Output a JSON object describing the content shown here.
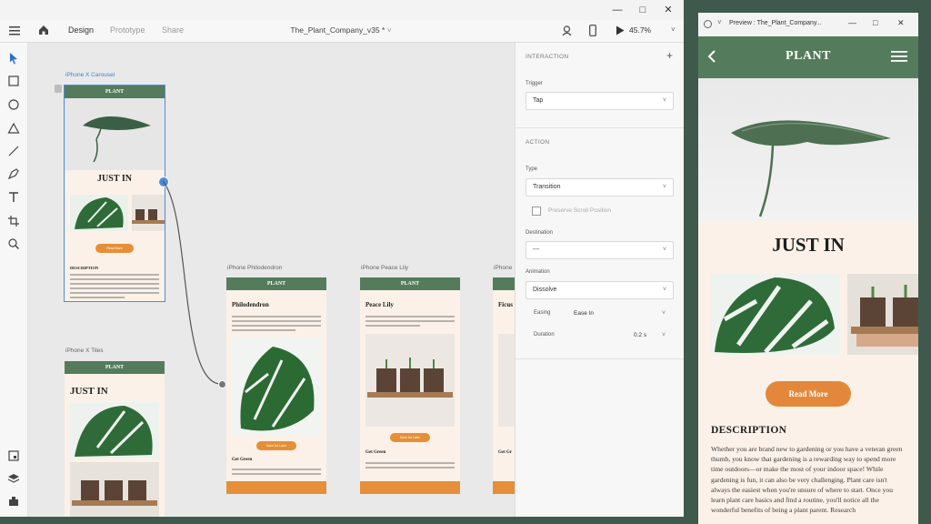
{
  "xd": {
    "tabs": [
      "Design",
      "Prototype",
      "Share"
    ],
    "active_tab": "Design",
    "document_title": "The_Plant_Company_v35 *",
    "zoom": "45.7%"
  },
  "artboards": {
    "carousel": {
      "label": "iPhone X Carousel",
      "brand": "PLANT",
      "heading": "JUST IN",
      "button": "Read More",
      "section": "DESCRIPTION"
    },
    "tiles": {
      "label": "iPhone X Tiles",
      "brand": "PLANT",
      "heading": "JUST IN"
    },
    "philodendron": {
      "label": "iPhone Philodendron",
      "brand": "PLANT",
      "heading": "Philodendron",
      "button": "Save for Later",
      "sub": "Get Green"
    },
    "peace_lily": {
      "label": "iPhone Peace Lily",
      "brand": "PLANT",
      "heading": "Peace Lily",
      "button": "Save for Later",
      "sub": "Get Green"
    },
    "partial": {
      "label": "iPhone",
      "heading": "Ficus I",
      "sub": "Get Gr"
    }
  },
  "interaction_panel": {
    "interaction_heading": "INTERACTION",
    "trigger_label": "Trigger",
    "trigger_value": "Tap",
    "action_heading": "ACTION",
    "type_label": "Type",
    "type_value": "Transition",
    "preserve_scroll_label": "Preserve Scroll Position",
    "destination_label": "Destination",
    "destination_value": "---",
    "animation_label": "Animation",
    "animation_value": "Dissolve",
    "easing_label": "Easing",
    "easing_value": "Ease In",
    "duration_label": "Duration",
    "duration_value": "0.2 s"
  },
  "preview": {
    "window_title": "Preview : The_Plant_Company...",
    "brand": "PLANT",
    "heading": "JUST IN",
    "button": "Read More",
    "description_heading": "DESCRIPTION",
    "description_text": "Whether you are brand new to gardening or you have a veteran green thumb, you know that gardening is a rewarding way to spend more time outdoors—or make the most of your indoor space! While gardening is fun, it can also be very challenging. Plant care isn't always the easiest when you're unsure of where to start. Once you learn plant care basics and find a routine, you'll notice all the wonderful benefits of being a plant parent. Research"
  },
  "colors": {
    "brand_green": "#547c5c",
    "accent_orange": "#e3883a",
    "page_cream": "#fbf1e8",
    "selection_blue": "#4b8de0"
  },
  "icons": [
    "hamburger-menu-icon",
    "home-icon",
    "user-preview-icon",
    "mobile-preview-icon",
    "play-icon",
    "select-tool-icon",
    "rectangle-tool-icon",
    "ellipse-tool-icon",
    "triangle-tool-icon",
    "line-tool-icon",
    "pen-tool-icon",
    "text-tool-icon",
    "artboard-tool-icon",
    "zoom-tool-icon",
    "assets-icon",
    "layers-icon",
    "plugins-icon",
    "back-arrow-icon",
    "menu-icon",
    "plus-icon",
    "chevron-down-icon"
  ]
}
